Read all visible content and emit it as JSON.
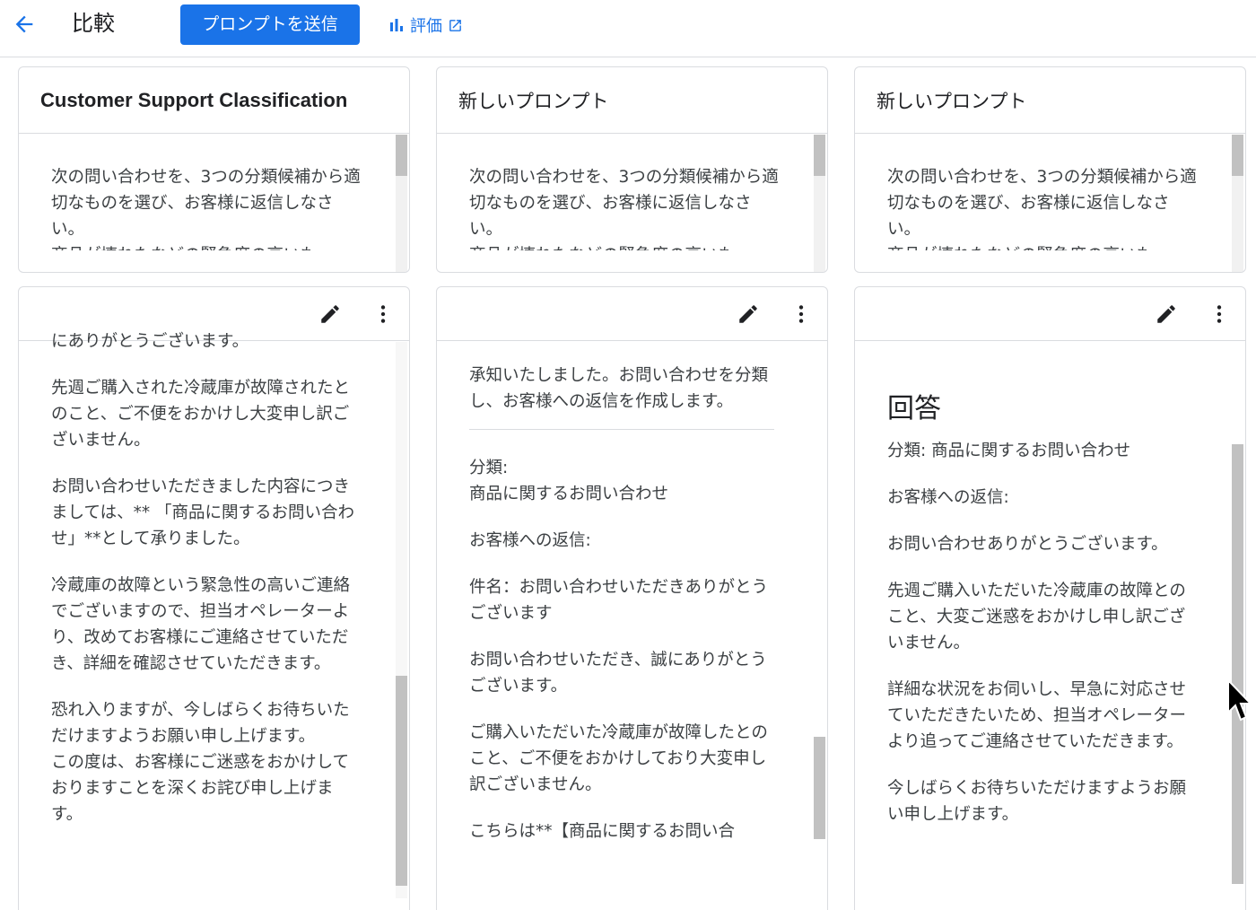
{
  "header": {
    "title": "比較",
    "send_label": "プロンプトを送信",
    "eval_label": "評価"
  },
  "prompts": [
    {
      "title": "Customer Support Classification",
      "text": "次の問い合わせを、3つの分類候補から適切なものを選び、お客様に返信しなさい。\n商品が壊れたなどの緊急度の高いも"
    },
    {
      "title": "新しいプロンプト",
      "text": "次の問い合わせを、3つの分類候補から適切なものを選び、お客様に返信しなさい。\n商品が壊れたなどの緊急度の高いも"
    },
    {
      "title": "新しいプロンプト",
      "text": "次の問い合わせを、3つの分類候補から適切なものを選び、お客様に返信しなさい。\n商品が壊れたなどの緊急度の高いも"
    }
  ],
  "responses": [
    {
      "paragraphs": [
        "にありがとうございます。",
        "先週ご購入された冷蔵庫が故障されたとのこと、ご不便をおかけし大変申し訳ございません。",
        "お問い合わせいただきました内容につきましては、** 「商品に関するお問い合わせ」**として承りました。",
        "冷蔵庫の故障という緊急性の高いご連絡でございますので、担当オペレーターより、改めてお客様にご連絡させていただき、詳細を確認させていただきます。",
        "恐れ入りますが、今しばらくお待ちいただけますようお願い申し上げます。\nこの度は、お客様にご迷惑をおかけしておりますことを深くお詫び申し上げます。"
      ]
    },
    {
      "intro": "承知いたしました。お問い合わせを分類し、お客様への返信を作成します。",
      "paragraphs": [
        "分類:\n商品に関するお問い合わせ",
        "お客様への返信:",
        "件名：お問い合わせいただきありがとうございます",
        "お問い合わせいただき、誠にありがとうございます。",
        "ご購入いただいた冷蔵庫が故障したとのこと、ご不便をおかけしており大変申し訳ございません。",
        "こちらは**【商品に関するお問い合"
      ]
    },
    {
      "heading": "回答",
      "paragraphs": [
        "分類: 商品に関するお問い合わせ",
        "お客様への返信:",
        "お問い合わせありがとうございます。",
        "先週ご購入いただいた冷蔵庫の故障とのこと、大変ご迷惑をおかけし申し訳ございません。",
        "詳細な状況をお伺いし、早急に対応させていただきたいため、担当オペレーターより追ってご連絡させていただきます。",
        "今しばらくお待ちいただけますようお願い申し上げます。"
      ]
    }
  ],
  "colors": {
    "accent": "#1a73e8",
    "border": "#dadce0",
    "text": "#3c4043"
  },
  "icons": [
    "back-arrow-icon",
    "bar-chart-icon",
    "open-in-new-icon",
    "pencil-icon",
    "more-vert-icon",
    "mouse-cursor-icon"
  ]
}
